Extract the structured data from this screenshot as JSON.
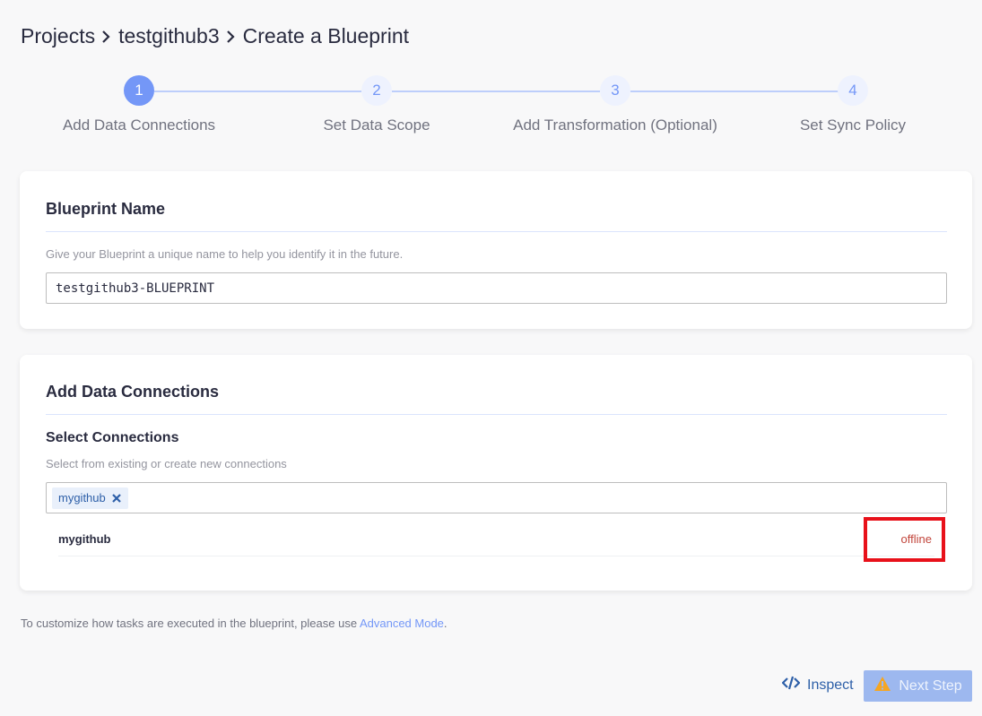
{
  "breadcrumb": {
    "items": [
      "Projects",
      "testgithub3",
      "Create a Blueprint"
    ]
  },
  "stepper": {
    "steps": [
      {
        "number": "1",
        "label": "Add Data Connections",
        "active": true
      },
      {
        "number": "2",
        "label": "Set Data Scope",
        "active": false
      },
      {
        "number": "3",
        "label": "Add Transformation (Optional)",
        "active": false
      },
      {
        "number": "4",
        "label": "Set Sync Policy",
        "active": false
      }
    ]
  },
  "blueprint_name_card": {
    "title": "Blueprint Name",
    "hint": "Give your Blueprint a unique name to help you identify it in the future.",
    "input_value": "testgithub3-BLUEPRINT"
  },
  "connections_card": {
    "title": "Add Data Connections",
    "subtitle": "Select Connections",
    "hint": "Select from existing or create new connections",
    "selected_tags": [
      "mygithub"
    ],
    "connections": [
      {
        "name": "mygithub",
        "status": "offline"
      }
    ]
  },
  "footnote": {
    "text": "To customize how tasks are executed in the blueprint, please use ",
    "link": "Advanced Mode",
    "suffix": "."
  },
  "actions": {
    "inspect_label": "Inspect",
    "next_label": "Next Step"
  },
  "colors": {
    "primary": "#7497f7",
    "step_line": "#bdcefb",
    "status_offline": "#c2463c",
    "highlight_box": "#e8111a",
    "warning_icon": "#f5a623"
  }
}
